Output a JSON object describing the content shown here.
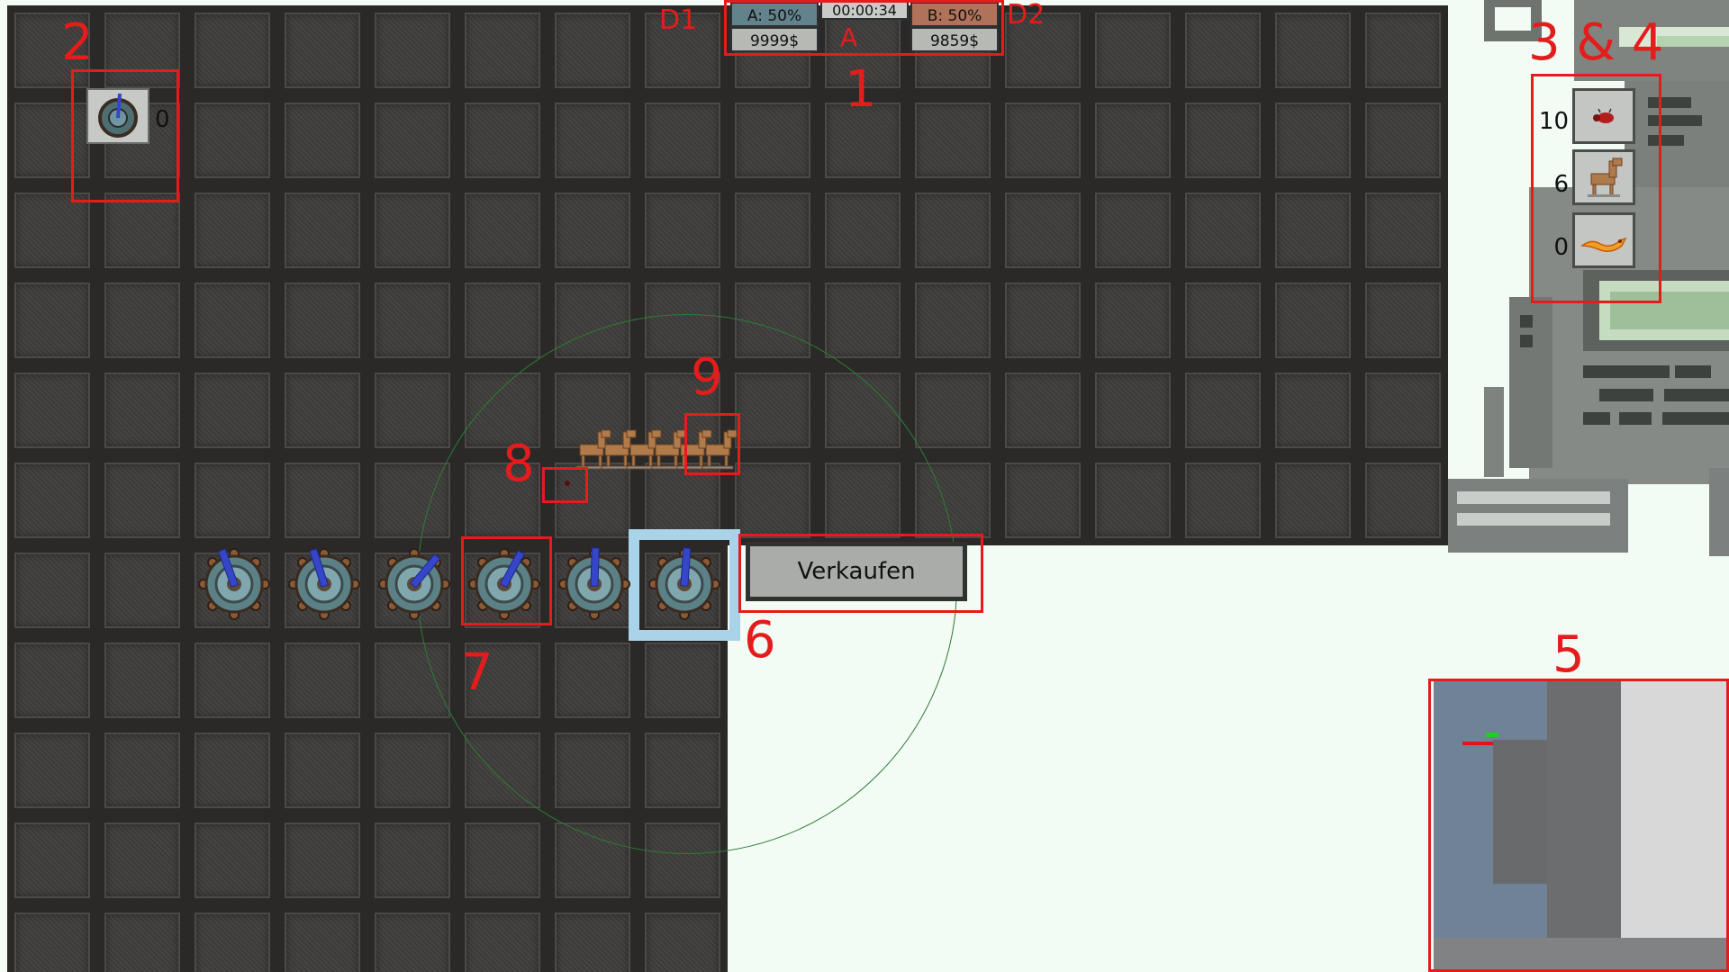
{
  "hud": {
    "team_a_share": "A: 50%",
    "team_b_share": "B: 50%",
    "timer": "00:00:34",
    "team_a_money": "9999$",
    "team_b_money": "9859$",
    "side_a_marker": "A",
    "left_tag": "D1",
    "right_tag": "D2",
    "colors": {
      "team_a": "#62828c",
      "team_b": "#b0735a"
    }
  },
  "tower_shop": {
    "tower_icon": "turret-icon",
    "count": "0"
  },
  "unit_shop": {
    "units": [
      {
        "icon": "beetle-icon",
        "count": "10"
      },
      {
        "icon": "trojan-horse-icon",
        "count": "6"
      },
      {
        "icon": "fire-worm-icon",
        "count": "0"
      }
    ]
  },
  "context_menu": {
    "sell_label": "Verkaufen"
  },
  "annotations": {
    "hud": "1",
    "tower_shop": "2",
    "unit_shop": "3 & 4",
    "minimap": "5",
    "sell_button": "6",
    "tower": "7",
    "projectile": "8",
    "unit": "9"
  },
  "colors": {
    "annotation": "#e41c1c",
    "selection": "#a9d3e8",
    "range_circle": "#2e7d32"
  }
}
